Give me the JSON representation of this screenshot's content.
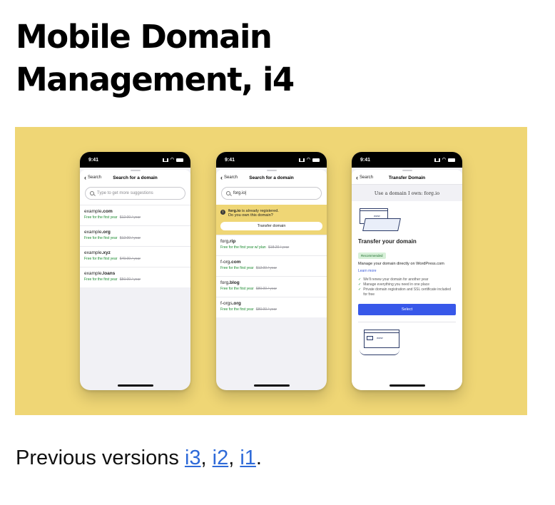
{
  "page": {
    "title_line1": "Mobile Domain",
    "title_line2": "Management, i4",
    "banner_bg": "#efd675"
  },
  "phones": [
    {
      "time": "9:41",
      "back_label": "Search",
      "nav_title": "Search for a domain",
      "search_placeholder": "Type to get more suggestions",
      "rows": [
        {
          "name_pre": "example",
          "name_tld": ".com",
          "offer": "Free for the first year",
          "price": "$12.00 / year"
        },
        {
          "name_pre": "example",
          "name_tld": ".org",
          "offer": "Free for the first year",
          "price": "$12.00 / year"
        },
        {
          "name_pre": "example",
          "name_tld": ".xyz",
          "offer": "Free for the first year",
          "price": "$49.00 / year"
        },
        {
          "name_pre": "example",
          "name_tld": ".loans",
          "offer": "Free for the first year",
          "price": "$50.00 / year"
        }
      ]
    },
    {
      "time": "9:41",
      "back_label": "Search",
      "nav_title": "Search for a domain",
      "search_value": "forg.io|",
      "notice_domain": "forg.io",
      "notice_text": " is already registered.",
      "notice_question": "Do you own this domain?",
      "notice_button": "Transfer domain",
      "rows": [
        {
          "name_pre": "forg",
          "name_tld": ".rip",
          "offer": "Free for the first year w/ plan",
          "price": "$18.20 / year"
        },
        {
          "name_pre": "f-org",
          "name_tld": ".com",
          "offer": "Free for the first year",
          "price": "$12.00 / year"
        },
        {
          "name_pre": "forg",
          "name_tld": ".blog",
          "offer": "Free for the first year",
          "price": "$80.00 / year"
        },
        {
          "name_pre": "f-orgs",
          "name_tld": ".org",
          "offer": "Free for the first year",
          "price": "$80.00 / year"
        }
      ]
    },
    {
      "time": "9:41",
      "back_label": "Search",
      "nav_title": "Transfer Domain",
      "use_own": "Use a domain I own: forg.io",
      "illus_www": "www",
      "transfer_title": "Transfer your domain",
      "badge": "Recommended",
      "description": "Manage your domain directly on WordPress.com",
      "learn_more": "Learn more",
      "checks": [
        "We'll renew your domain for another year",
        "Manage everything you need in one place",
        "Private domain registration and SSL certificate included for free"
      ],
      "select_button": "Select",
      "illus2_www": "www"
    }
  ],
  "footer": {
    "prefix": "Previous versions ",
    "links": [
      "i3",
      "i2",
      "i1"
    ],
    "sep1": ", ",
    "sep2": ", ",
    "suffix": "."
  }
}
